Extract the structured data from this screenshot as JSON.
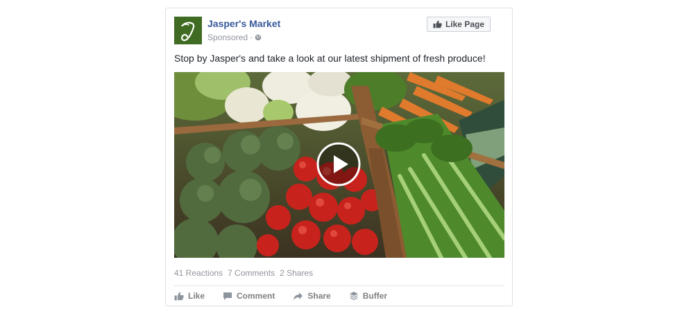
{
  "post": {
    "page_name": "Jasper's Market",
    "sponsored_label": "Sponsored",
    "meta_separator": "·",
    "like_page_label": "Like Page",
    "text": "Stop by Jasper's and take a look at our latest shipment of fresh produce!",
    "avatar_letter": "J",
    "brand_color": "#3f6b22",
    "link_color": "#365899"
  },
  "stats": {
    "reactions": "41 Reactions",
    "comments": "7 Comments",
    "shares": "2 Shares"
  },
  "actions": {
    "like": "Like",
    "comment": "Comment",
    "share": "Share",
    "buffer": "Buffer"
  },
  "icons": {
    "avatar": "script-j-logo",
    "globe": "globe-icon",
    "thumbs_up": "thumbs-up-icon",
    "play": "play-icon",
    "comment": "comment-icon",
    "share": "share-arrow-icon",
    "buffer": "buffer-stack-icon"
  }
}
